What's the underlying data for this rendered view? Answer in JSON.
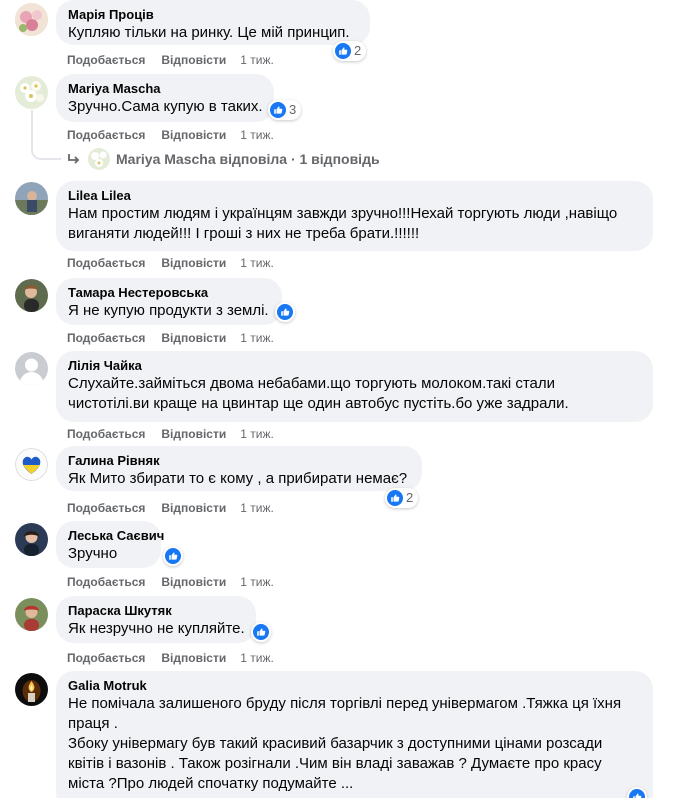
{
  "actions": {
    "like": "Подобається",
    "reply": "Відповісти"
  },
  "colors": {
    "bubble": "#f0f2f5",
    "secondary_text": "#65676b",
    "like_blue": "#1877f2"
  },
  "comments": [
    {
      "author": "Марія Проців",
      "lines": [
        "Купляю тільки на ринку. Це мій принцип."
      ],
      "time": "1 тиж.",
      "reactions": "2",
      "avatar": "flowers-avatar"
    },
    {
      "author": "Mariya Mascha",
      "lines": [
        "Зручно.Сама купую в таких."
      ],
      "time": "1 тиж.",
      "reactions": "3",
      "avatar": "white-flowers-avatar"
    },
    {
      "author": "Lilea Lilea",
      "lines": [
        "Нам простим людям і українцям завжди зручно!!!Нехай торгують люди ,навіщо",
        "виганяти людей!!! І гроші з них не треба брати.!!!!!!"
      ],
      "time": "1 тиж.",
      "reactions": "",
      "avatar": "outdoor-photo-avatar"
    },
    {
      "author": "Тамара Нестеровська",
      "lines": [
        "Я не купую продукти з землі."
      ],
      "time": "1 тиж.",
      "reactions": "",
      "avatar": "portrait-avatar"
    },
    {
      "author": "Лілія Чайка",
      "lines": [
        "Слухайте.займіться двома небабами.що торгують молоком.такі стали",
        "чистотілі.ви краще на цвинтар ще один автобус пустіть.бо уже задрали."
      ],
      "time": "1 тиж.",
      "reactions": "",
      "avatar": "default-avatar"
    },
    {
      "author": "Галина Рівняк",
      "lines": [
        "Як Мито збирати то є кому , а прибирати немає?"
      ],
      "time": "1 тиж.",
      "reactions": "2",
      "avatar": "ukraine-heart-avatar"
    },
    {
      "author": "Леська Саєвич",
      "lines": [
        "Зручно"
      ],
      "time": "1 тиж.",
      "reactions": "",
      "avatar": "woman-avatar"
    },
    {
      "author": "Параска Шкутяк",
      "lines": [
        "Як незручно не купляйте."
      ],
      "time": "1 тиж.",
      "reactions": "",
      "avatar": "woman-outdoor-avatar"
    },
    {
      "author": "Galia Motruk",
      "lines": [
        "Не помічала залишеного бруду після торгівлі перед універмагом .Тяжка ця їхня",
        "праця .",
        "Збоку універмагу був такий красивий базарчик з доступними цінами розсади",
        "квітів і вазонів . Також розігнали .Чим він владі заважав ? Думаєте про красу",
        "міста ?Про людей спочатку подумайте ..."
      ],
      "time": "",
      "reactions": "",
      "avatar": "candle-avatar"
    }
  ],
  "reply_summary": {
    "text": "Mariya Mascha відповіла · 1 відповідь"
  }
}
